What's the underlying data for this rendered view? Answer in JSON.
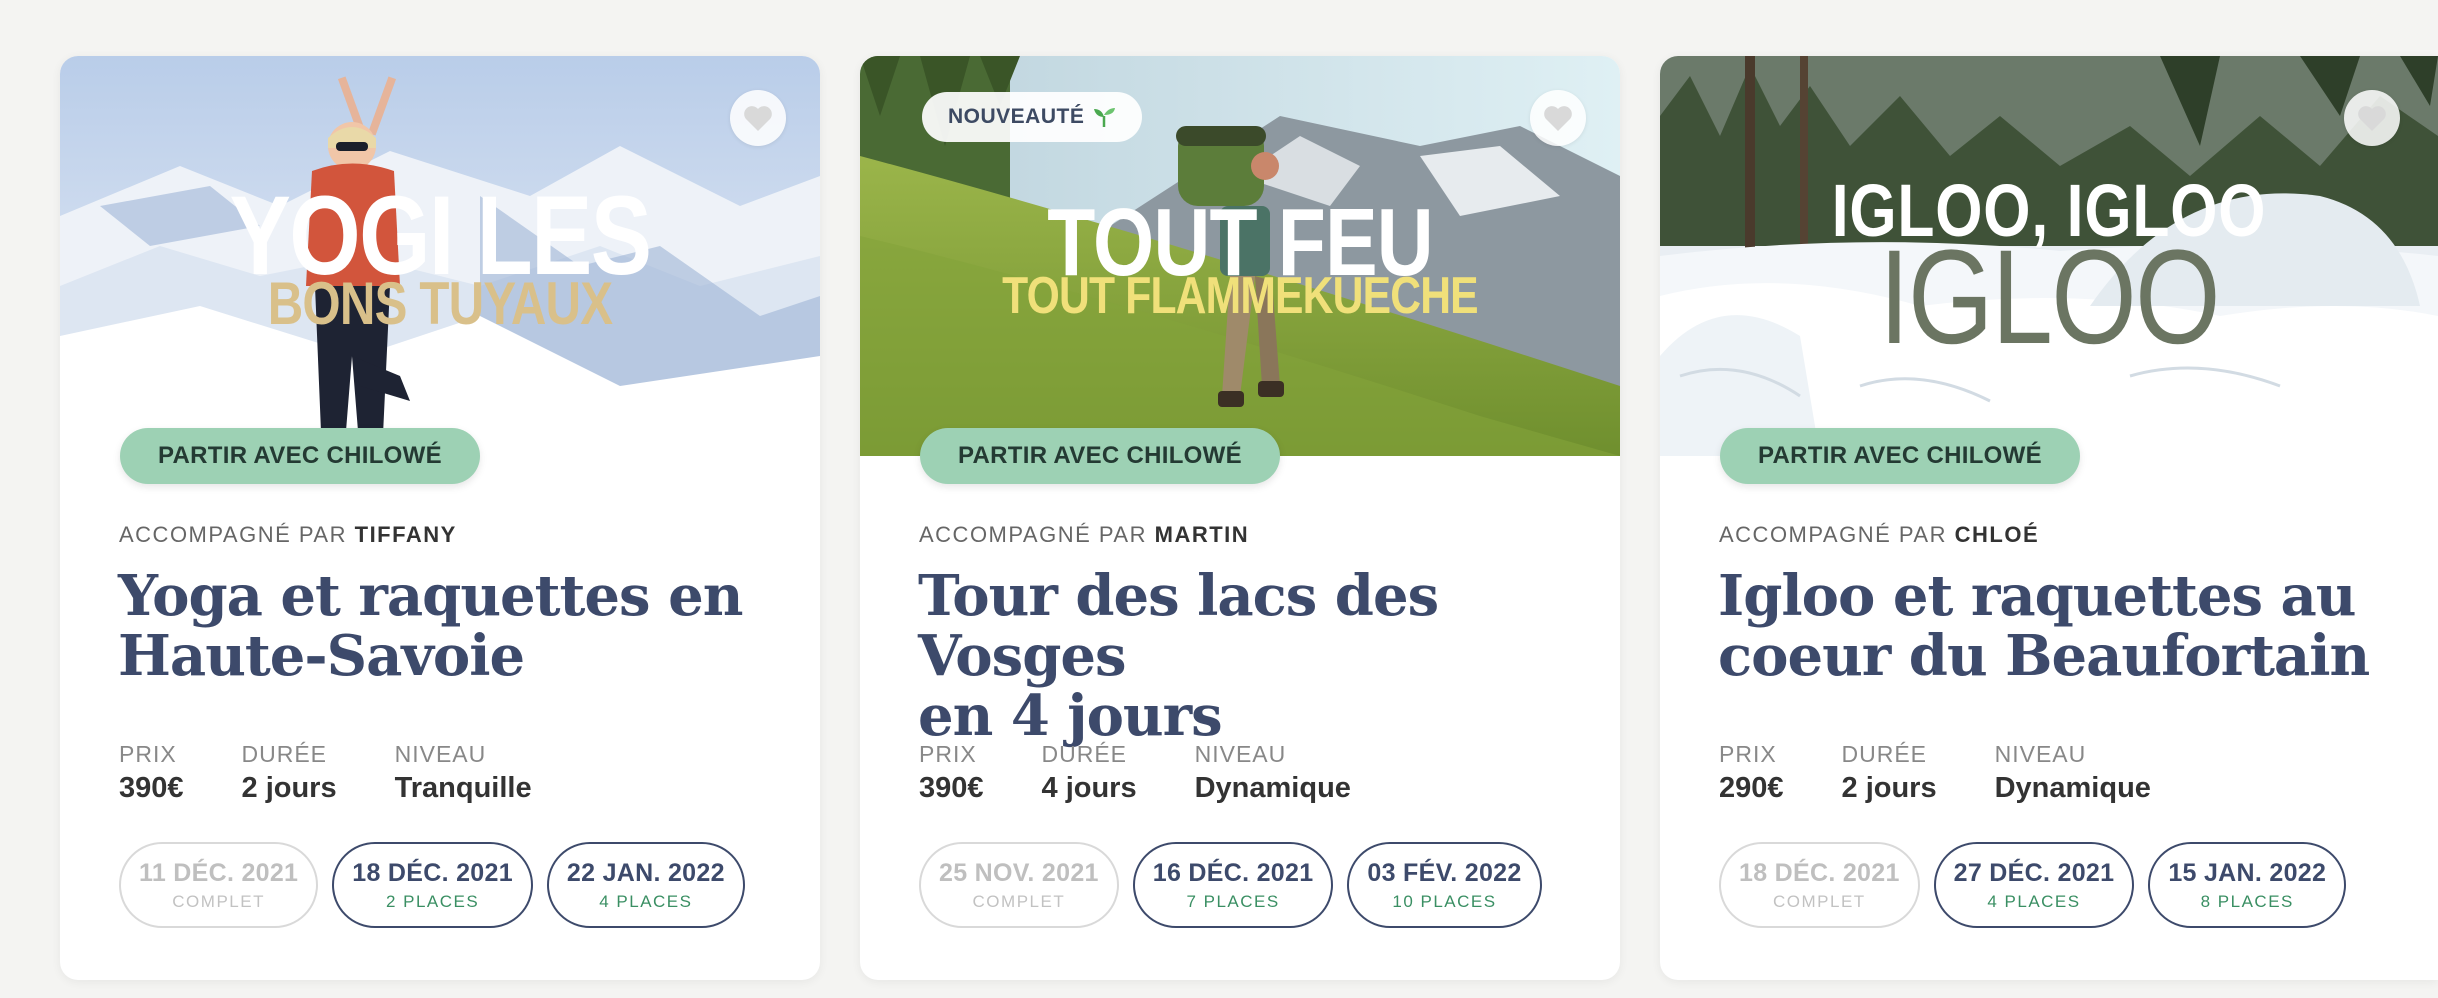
{
  "cards": [
    {
      "headline_line1": "YOGI LES",
      "headline_line2": "BONS TUYAUX",
      "badge": "",
      "cta": "PARTIR AVEC CHILOWÉ",
      "guide_prefix": "ACCOMPAGNÉ PAR",
      "guide_name": "TIFFANY",
      "title_line1": "Yoga et raquettes en",
      "title_line2": "Haute-Savoie",
      "price_label": "PRIX",
      "price": "390€",
      "duration_label": "DURÉE",
      "duration": "2 jours",
      "level_label": "NIVEAU",
      "level": "Tranquille",
      "dates": [
        {
          "date": "11 DÉC. 2021",
          "status": "COMPLET"
        },
        {
          "date": "18 DÉC. 2021",
          "status": "2 PLACES"
        },
        {
          "date": "22 JAN. 2022",
          "status": "4 PLACES"
        }
      ]
    },
    {
      "headline_line1": "TOUT FEU",
      "headline_line2": "TOUT FLAMMEKUECHE",
      "badge": "NOUVEAUTÉ",
      "cta": "PARTIR AVEC CHILOWÉ",
      "guide_prefix": "ACCOMPAGNÉ PAR",
      "guide_name": "MARTIN",
      "title_line1": "Tour des lacs des Vosges",
      "title_line2": "en 4 jours",
      "price_label": "PRIX",
      "price": "390€",
      "duration_label": "DURÉE",
      "duration": "4 jours",
      "level_label": "NIVEAU",
      "level": "Dynamique",
      "dates": [
        {
          "date": "25 NOV. 2021",
          "status": "COMPLET"
        },
        {
          "date": "16 DÉC. 2021",
          "status": "7 PLACES"
        },
        {
          "date": "03 FÉV. 2022",
          "status": "10 PLACES"
        }
      ]
    },
    {
      "headline_line1": "IGLOO, IGLOO",
      "headline_line2": "IGLOO",
      "badge": "",
      "cta": "PARTIR AVEC CHILOWÉ",
      "guide_prefix": "ACCOMPAGNÉ PAR",
      "guide_name": "CHLOÉ",
      "title_line1": "Igloo et raquettes au",
      "title_line2": "coeur du Beaufortain",
      "price_label": "PRIX",
      "price": "290€",
      "duration_label": "DURÉE",
      "duration": "2 jours",
      "level_label": "NIVEAU",
      "level": "Dynamique",
      "dates": [
        {
          "date": "18 DÉC. 2021",
          "status": "COMPLET"
        },
        {
          "date": "27 DÉC. 2021",
          "status": "4 PLACES"
        },
        {
          "date": "15 JAN. 2022",
          "status": "8 PLACES"
        }
      ]
    }
  ],
  "icons": {
    "favorite": "heart-icon",
    "badge": "sprout-icon"
  },
  "colors": {
    "title": "#3d4a6b",
    "cta_bg": "#9dd1b4",
    "places": "#3a8f63",
    "headline_gold": "#d9c08a",
    "headline_yellow": "#f0e07a",
    "headline_green": "#6b7562"
  }
}
